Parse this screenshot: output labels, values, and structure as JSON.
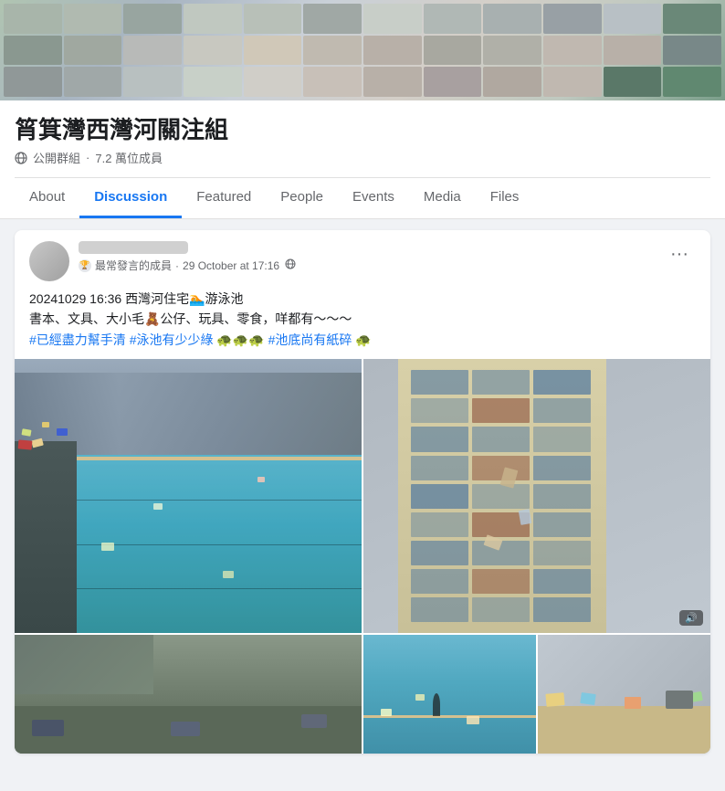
{
  "group": {
    "title": "筲箕灣西灣河關注組",
    "type": "公開群組",
    "members": "7.2 萬位成員",
    "meta_separator": "·"
  },
  "tabs": [
    {
      "id": "about",
      "label": "About",
      "active": false
    },
    {
      "id": "discussion",
      "label": "Discussion",
      "active": true
    },
    {
      "id": "featured",
      "label": "Featured",
      "active": false
    },
    {
      "id": "people",
      "label": "People",
      "active": false
    },
    {
      "id": "events",
      "label": "Events",
      "active": false
    },
    {
      "id": "media",
      "label": "Media",
      "active": false
    },
    {
      "id": "files",
      "label": "Files",
      "active": false
    }
  ],
  "post": {
    "author_placeholder": "",
    "badge": "最常發言的成員",
    "time": "29 October at 17:16",
    "globe": "🌐",
    "more": "···",
    "body_line1": "20241029 16:36 西灣河住宅🏊游泳池",
    "body_line2": "書本、文具、大小毛🧸公仔、玩具、零食，咩都有～～～",
    "body_line3": "#已經盡力幫手清 #泳池有少少綠🐢🐢🐢 #池底尚有紙碎🐢",
    "hashtag1": "#已經盡力幫手清",
    "hashtag2": "#泳池有少少綠",
    "hashtag3": "#池底尚有紙碎",
    "video_indicator": "🔊"
  },
  "colors": {
    "active_tab": "#1877f2",
    "text_primary": "#1c1e21",
    "text_secondary": "#65676b",
    "bg_page": "#f0f2f5",
    "bg_card": "#ffffff",
    "border": "#e0e0e0"
  }
}
